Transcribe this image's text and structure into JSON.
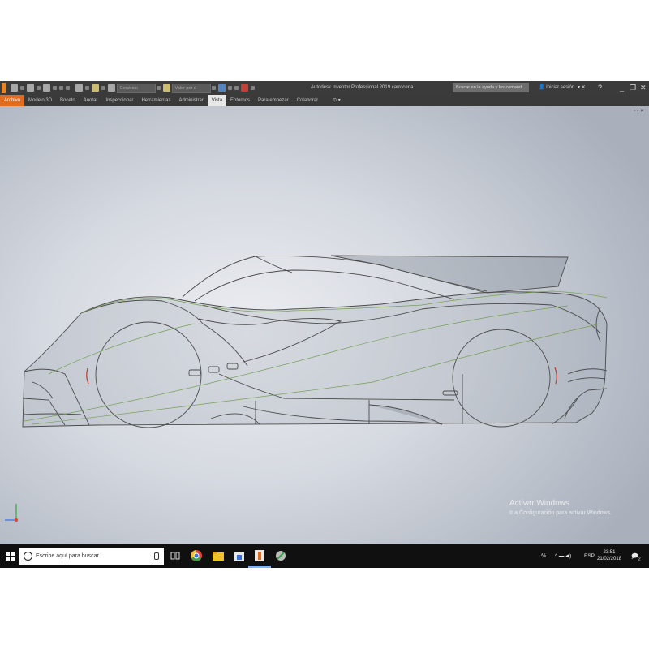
{
  "window": {
    "title": "Autodesk Inventor Professional 2019   carroceria",
    "qa_box_1": "Genérico",
    "qa_box_2": "Valor por d",
    "help_search_placeholder": "Buscar en la ayuda y los comand",
    "sign_in": "Iniciar sesión",
    "minimize": "_",
    "restore": "❐",
    "close": "✕"
  },
  "ribbon": {
    "tabs": [
      "Archivo",
      "Modelo 3D",
      "Boceto",
      "Anotar",
      "Inspeccionar",
      "Herramientas",
      "Administrar",
      "Vista",
      "Entornos",
      "Para empezar",
      "Colaborar"
    ],
    "active_tab": "Vista",
    "extra": "⊙ ▾"
  },
  "viewport": {
    "window_controls": "▫ ▫ ✕",
    "watermark_line1": "Activar Windows",
    "watermark_line2": "Ir a Configuración para activar Windows."
  },
  "taskbar": {
    "search_placeholder": "Escribe aquí para buscar",
    "tray_text": "ESP",
    "time": "23:51",
    "date": "21/02/2018",
    "notification_count": "2"
  },
  "colors": {
    "titlebar": "#3b3b3b",
    "file_tab": "#e36b1c",
    "taskbar": "#101010",
    "car_line": "#4a4a4a",
    "sketch_line": "#6e9a4a"
  }
}
